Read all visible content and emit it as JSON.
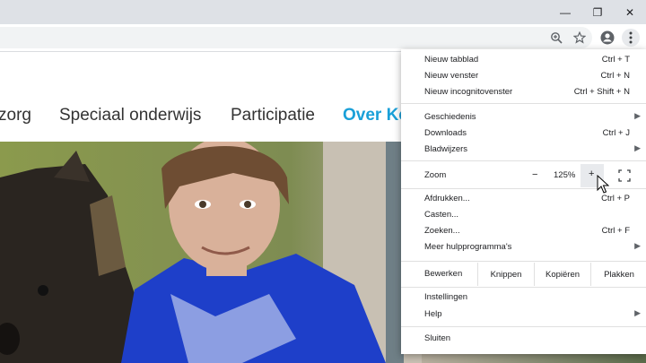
{
  "window": {
    "minimize_icon": "—",
    "restore_icon": "❐",
    "close_icon": "✕"
  },
  "toolbar": {
    "zoom_icon": "zoom-icon",
    "star_icon": "star-icon",
    "account_icon": "account-icon",
    "menu_icon": "kebab-menu-icon"
  },
  "site": {
    "nav": [
      "zorg",
      "Speciaal onderwijs",
      "Participatie",
      "Over Ko"
    ],
    "accent": "#1aa0d8"
  },
  "menu": {
    "group1": [
      {
        "label": "Nieuw tabblad",
        "shortcut": "Ctrl + T"
      },
      {
        "label": "Nieuw venster",
        "shortcut": "Ctrl + N"
      },
      {
        "label": "Nieuw incognitovenster",
        "shortcut": "Ctrl + Shift + N"
      }
    ],
    "group2": [
      {
        "label": "Geschiedenis",
        "shortcut": ""
      },
      {
        "label": "Downloads",
        "shortcut": "Ctrl + J"
      },
      {
        "label": "Bladwijzers",
        "shortcut": ""
      }
    ],
    "zoom": {
      "label": "Zoom",
      "minus": "−",
      "value": "125%",
      "plus": "+"
    },
    "group3": [
      {
        "label": "Afdrukken...",
        "shortcut": "Ctrl + P"
      },
      {
        "label": "Casten...",
        "shortcut": ""
      },
      {
        "label": "Zoeken...",
        "shortcut": "Ctrl + F"
      },
      {
        "label": "Meer hulpprogramma's",
        "shortcut": ""
      }
    ],
    "edit": {
      "label": "Bewerken",
      "cut": "Knippen",
      "copy": "Kopiëren",
      "paste": "Plakken"
    },
    "group4": [
      {
        "label": "Instellingen",
        "shortcut": ""
      },
      {
        "label": "Help",
        "shortcut": ""
      }
    ],
    "exit": "Sluiten"
  }
}
